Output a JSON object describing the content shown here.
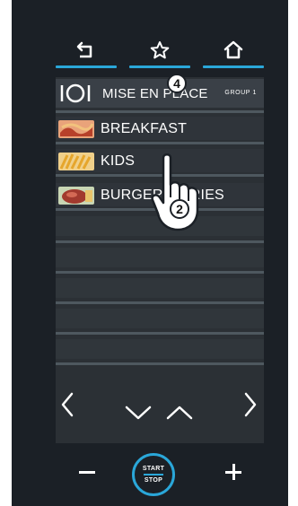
{
  "colors": {
    "accent": "#2aa7d9",
    "panel": "#1b2026",
    "screen": "#2b3035"
  },
  "top_nav": {
    "back_icon": "back-arrow-icon",
    "favorite_icon": "star-icon",
    "home_icon": "home-icon"
  },
  "annotations": {
    "callout_top": "4",
    "callout_hand": "2"
  },
  "menu": {
    "group_row": {
      "label": "MISE EN PLACE",
      "tag": "GROUP 1",
      "icon": "plate-icon"
    },
    "items": [
      {
        "label": "BREAKFAST",
        "thumb": "breakfast-thumb"
      },
      {
        "label": "KIDS",
        "thumb": "fries-thumb"
      },
      {
        "label": "BURGER & FRIES",
        "thumb": "burger-thumb"
      }
    ]
  },
  "bottom_controls": {
    "start_label": "START",
    "stop_label": "STOP",
    "minus_icon": "minus-icon",
    "plus_icon": "plus-icon"
  }
}
